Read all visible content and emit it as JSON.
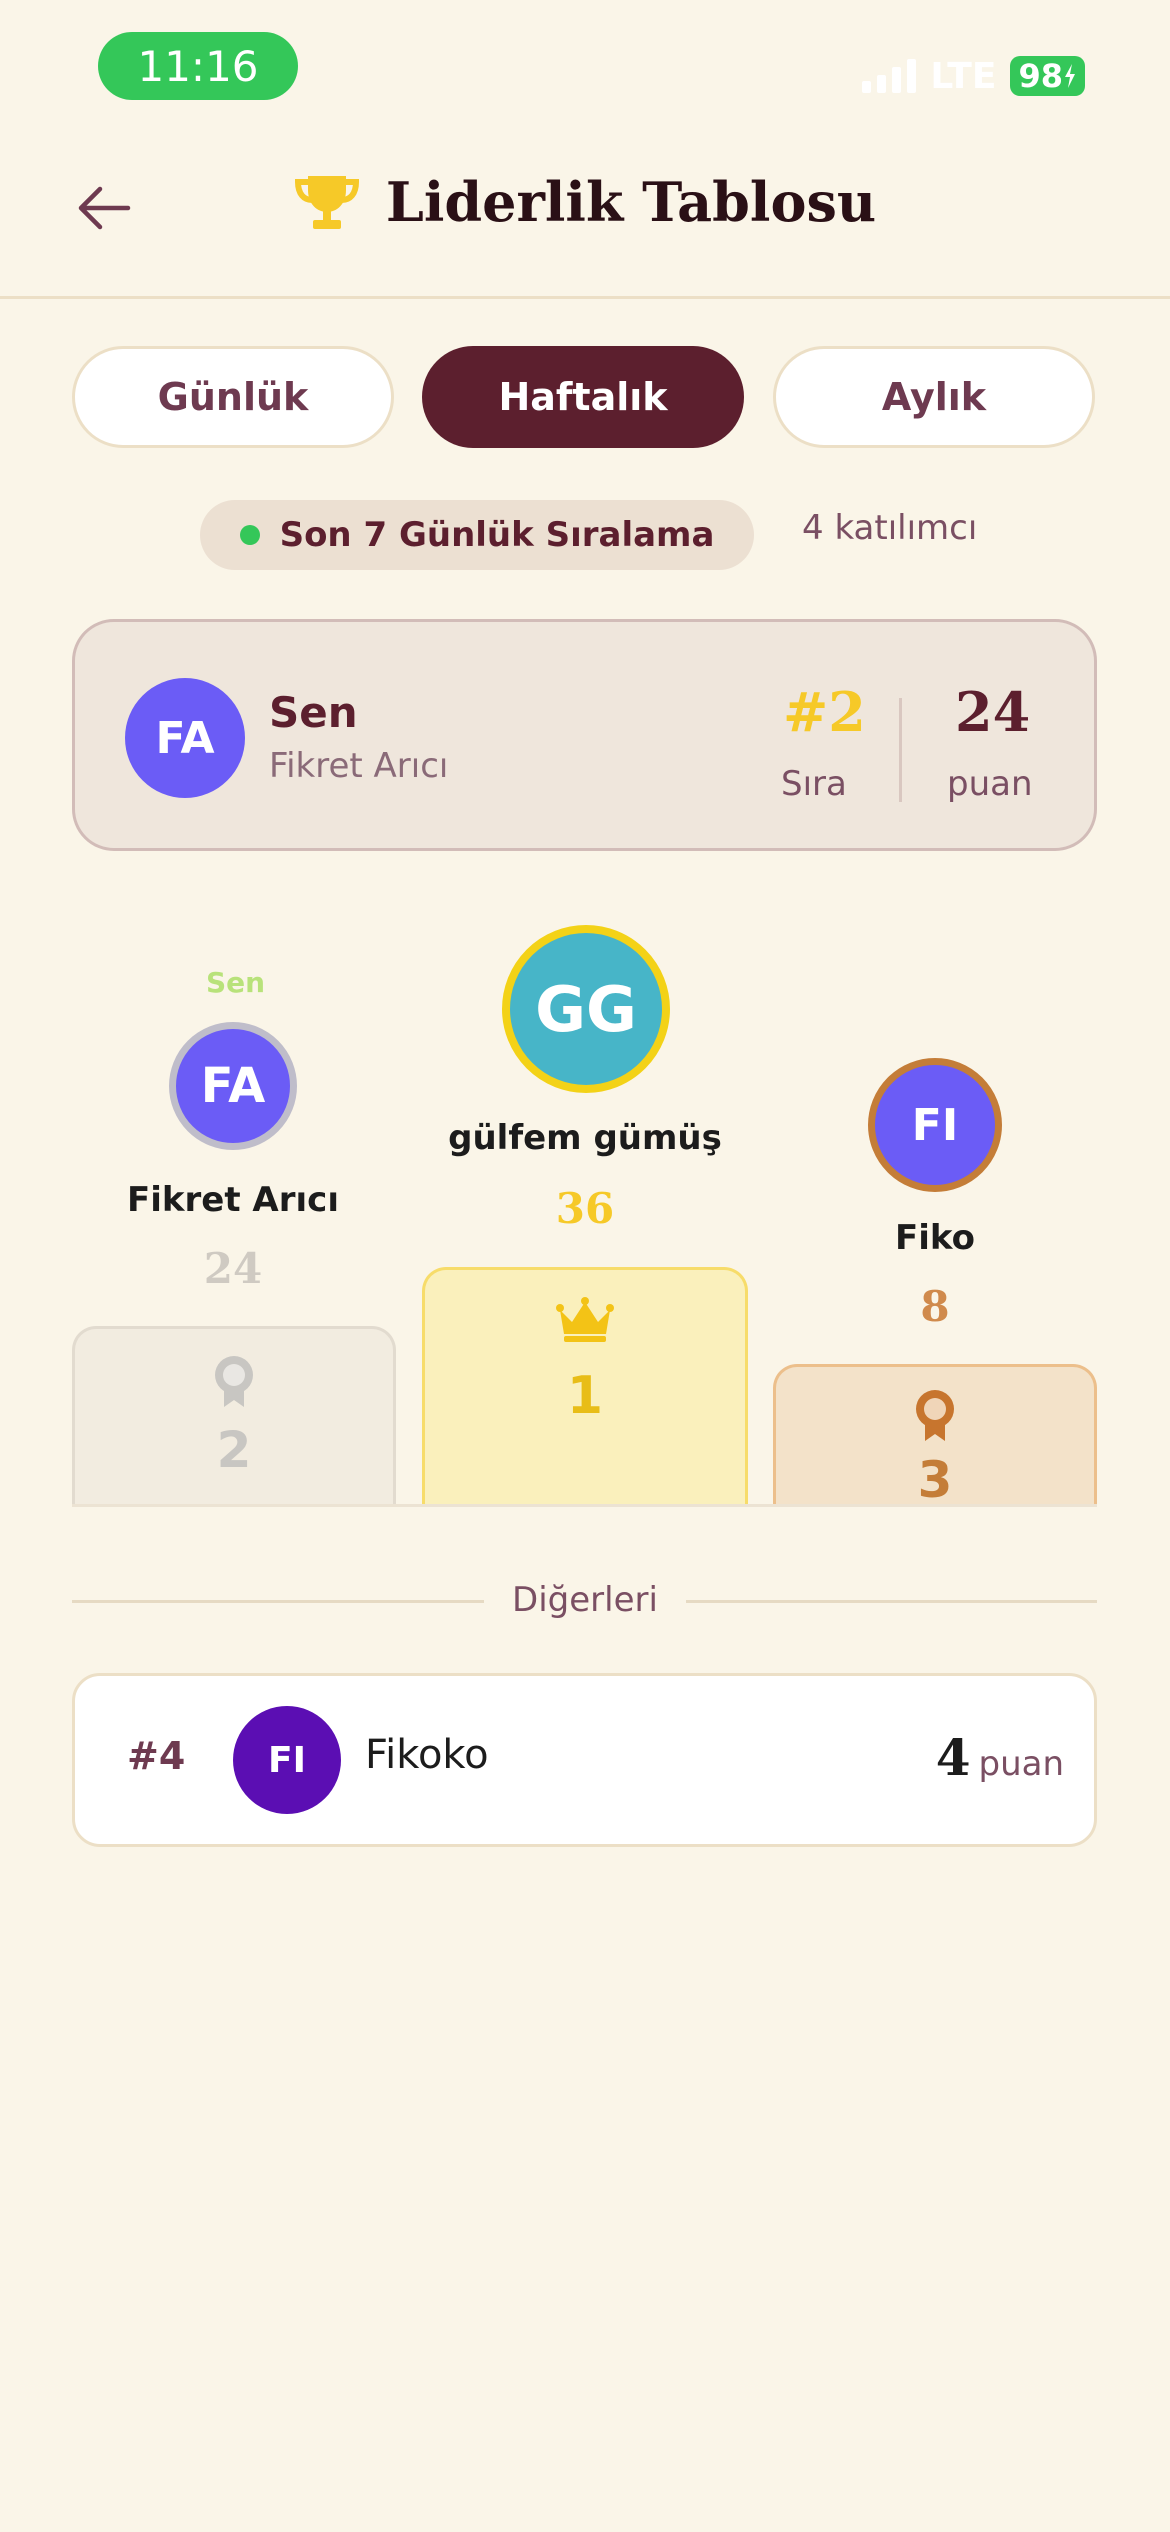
{
  "status_bar": {
    "time": "11:16",
    "network": "LTE",
    "battery": "98"
  },
  "header": {
    "title": "Liderlik Tablosu"
  },
  "tabs": [
    {
      "label": "Günlük",
      "active": false
    },
    {
      "label": "Haftalık",
      "active": true
    },
    {
      "label": "Aylık",
      "active": false
    }
  ],
  "info": {
    "range_label": "Son 7 Günlük Sıralama",
    "participants": "4 katılımcı"
  },
  "me": {
    "initials": "FA",
    "title": "Sen",
    "name": "Fikret Arıcı",
    "rank": "#2",
    "rank_label": "Sıra",
    "points": "24",
    "points_label": "puan"
  },
  "podium": {
    "you_tag": "Sen",
    "first": {
      "initials": "GG",
      "name": "gülfem gümüş",
      "points": "36",
      "place": "1"
    },
    "second": {
      "initials": "FA",
      "name": "Fikret Arıcı",
      "points": "24",
      "place": "2"
    },
    "third": {
      "initials": "FI",
      "name": "Fiko",
      "points": "8",
      "place": "3"
    }
  },
  "others": {
    "label": "Diğerleri",
    "rows": [
      {
        "rank": "#4",
        "initials": "FI",
        "name": "Fikoko",
        "points": "4",
        "points_label": "puan"
      }
    ]
  },
  "colors": {
    "background": "#faf5e8",
    "accent": "#5c1f2e",
    "gold": "#f6c928",
    "silver": "#bfbdca",
    "bronze": "#c47d38",
    "avatar_purple": "#6b5cf6",
    "avatar_teal": "#47b5c8",
    "status_green": "#34c759"
  },
  "icons": [
    "back-arrow-icon",
    "trophy-icon",
    "crown-icon",
    "silver-medal-icon",
    "bronze-medal-icon",
    "signal-icon",
    "battery-icon"
  ]
}
